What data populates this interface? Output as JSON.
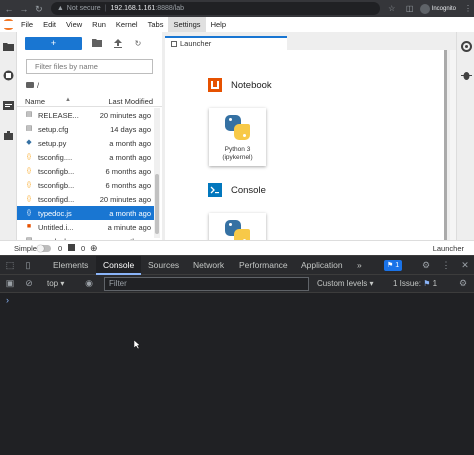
{
  "browser": {
    "security_label": "Not secure",
    "host": "192.168.1.161",
    "path": ":8888/lab",
    "profile_label": "Incognito"
  },
  "menu": [
    "File",
    "Edit",
    "View",
    "Run",
    "Kernel",
    "Tabs",
    "Settings",
    "Help"
  ],
  "file_browser": {
    "new_label": "+",
    "filter_placeholder": "Filter files by name",
    "path": "/",
    "col_name": "Name",
    "col_modified": "Last Modified",
    "files": [
      {
        "name": "RELEASE...",
        "modified": "20 minutes ago",
        "icon": "file-icon"
      },
      {
        "name": "setup.cfg",
        "modified": "14 days ago",
        "icon": "file-icon"
      },
      {
        "name": "setup.py",
        "modified": "a month ago",
        "icon": "python-file-icon"
      },
      {
        "name": "tsconfig....",
        "modified": "a month ago",
        "icon": "json-icon"
      },
      {
        "name": "tsconfigb...",
        "modified": "6 months ago",
        "icon": "json-icon"
      },
      {
        "name": "tsconfigb...",
        "modified": "6 months ago",
        "icon": "json-icon"
      },
      {
        "name": "tsconfigd...",
        "modified": "20 minutes ago",
        "icon": "json-icon"
      },
      {
        "name": "typedoc.js",
        "modified": "a month ago",
        "icon": "json-icon",
        "selected": true
      },
      {
        "name": "Untitled.i...",
        "modified": "a minute ago",
        "icon": "notebook-icon"
      },
      {
        "name": "yarn.lock",
        "modified": "a month ago",
        "icon": "file-icon"
      }
    ]
  },
  "launcher": {
    "tab_label": "Launcher",
    "notebook_title": "Notebook",
    "console_title": "Console",
    "kernel_label_1": "Python 3",
    "kernel_label_2": "(ipykernel)"
  },
  "status": {
    "mode": "Simple",
    "count_a": "0",
    "count_b": "0",
    "right": "Launcher"
  },
  "devtools": {
    "tabs": [
      "Elements",
      "Console",
      "Sources",
      "Network",
      "Performance",
      "Application"
    ],
    "active_tab": "Console",
    "more": "»",
    "issues_badge": "1",
    "context": "top",
    "filter_placeholder": "Filter",
    "levels": "Custom levels ▾",
    "issues_text": "1 Issue:",
    "issues_count": "1"
  },
  "colors": {
    "accent": "#1976d2",
    "jupyter_orange": "#f37726",
    "devtools_bg": "#202124"
  }
}
